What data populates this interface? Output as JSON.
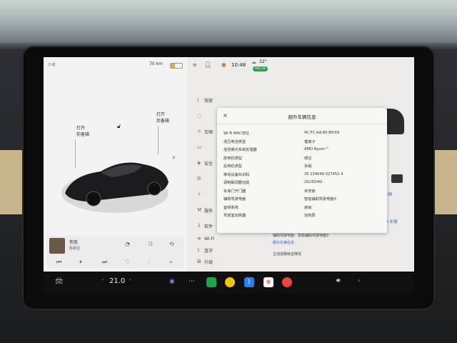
{
  "left_panel": {
    "range": "70 km",
    "frunk_open": "打开",
    "frunk_label": "前备箱",
    "trunk_open": "打开",
    "trunk_label": "后备箱",
    "media_title": "伤信",
    "media_artist": "陈奕迅"
  },
  "status": {
    "time": "10:48",
    "temp": "32°",
    "aqi": "AQI 20"
  },
  "menu": {
    "items": [
      "驾驶",
      "",
      "车辆",
      "",
      "安全",
      "",
      "",
      "服务",
      "软件",
      "Wi-Fi",
      "蓝牙",
      "升级"
    ]
  },
  "dialog": {
    "title": "额外车辆信息",
    "close": "×",
    "rows": [
      {
        "k": "Wi-Fi MAC地址",
        "v": "4C:FC:AA:80:B9:E9"
      },
      {
        "k": "低压电池类型",
        "v": "锂离子"
      },
      {
        "k": "信息娱乐系统处理器",
        "v": "AMD Ryzen™"
      },
      {
        "k": "前电机类型",
        "v": "感应"
      },
      {
        "k": "后电机类型",
        "v": "永磁"
      },
      {
        "k": "移动设备标识码",
        "v": "35 134049 027452 4"
      },
      {
        "k": "调制解调器功能",
        "v": "2G/3G/4G"
      },
      {
        "k": "车库门开门器",
        "v": "未安装"
      },
      {
        "k": "辅助驾驶电脑",
        "v": "智能辅助驾驶电脑3"
      },
      {
        "k": "音频系统",
        "v": "高级"
      },
      {
        "k": "驾驶室加热器",
        "v": "加热泵"
      }
    ]
  },
  "below_dialog": {
    "line1": "辅助驾驶电脑：智能辅助驾驶电脑3",
    "link1": "额外车辆信息",
    "line2": "主动道路噪音降低",
    "line3": "",
    "side_link1": "车辆",
    "side_link2": "入车辆"
  },
  "taskbar": {
    "temperature": "21.0",
    "colors": {
      "green": "#1fa34a",
      "yellow": "#f2c40c",
      "blue": "#2b7de9",
      "red": "#e8453c"
    }
  }
}
